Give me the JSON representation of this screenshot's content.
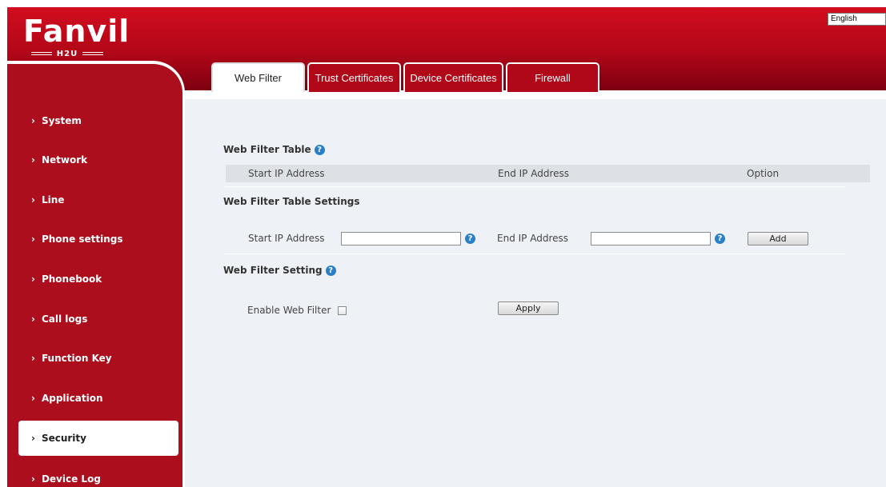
{
  "logo": {
    "brand": "Fanvil",
    "model": "H2U"
  },
  "language": {
    "selected": "English"
  },
  "tabs": [
    {
      "label": "Web Filter",
      "active": true
    },
    {
      "label": "Trust Certificates",
      "active": false
    },
    {
      "label": "Device Certificates",
      "active": false
    },
    {
      "label": "Firewall",
      "active": false
    }
  ],
  "sidebar": {
    "items": [
      {
        "label": "System"
      },
      {
        "label": "Network"
      },
      {
        "label": "Line"
      },
      {
        "label": "Phone settings"
      },
      {
        "label": "Phonebook"
      },
      {
        "label": "Call logs"
      },
      {
        "label": "Function Key"
      },
      {
        "label": "Application"
      },
      {
        "label": "Security",
        "active": true
      },
      {
        "label": "Device Log"
      }
    ]
  },
  "web_filter_table": {
    "title": "Web Filter Table",
    "columns": [
      "Start IP Address",
      "End IP Address",
      "Option"
    ],
    "rows": []
  },
  "table_settings": {
    "title": "Web Filter Table Settings",
    "start_ip_label": "Start IP Address",
    "start_ip_value": "",
    "end_ip_label": "End IP Address",
    "end_ip_value": "",
    "add_label": "Add"
  },
  "filter_setting": {
    "title": "Web Filter Setting",
    "enable_label": "Enable Web Filter",
    "enable_checked": false,
    "apply_label": "Apply"
  },
  "colors": {
    "brand_red": "#b10718",
    "content_bg": "#eef1f5",
    "help_blue": "#2a7fc9"
  }
}
